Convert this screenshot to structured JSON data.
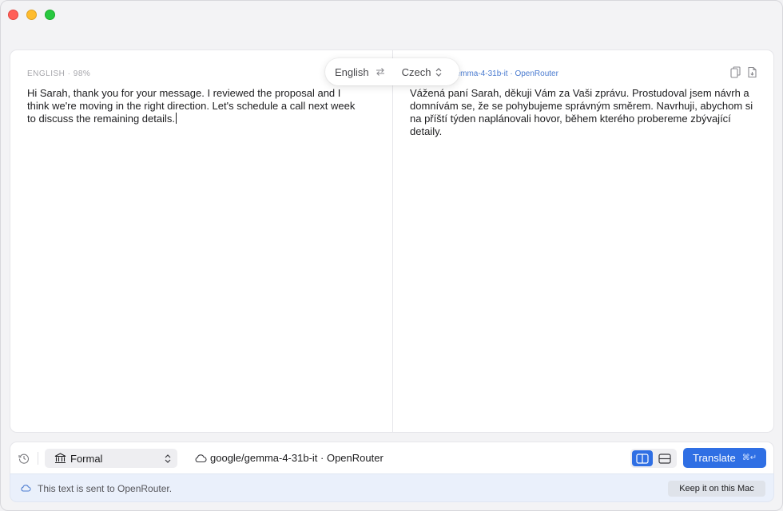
{
  "source": {
    "meta": "ENGLISH · 98%",
    "text": "Hi Sarah, thank you for your message. I reviewed the proposal and I think we're moving in the right direction. Let's schedule a call next week to discuss the remaining details."
  },
  "target": {
    "meta": "gemma-4-31b-it · OpenRouter",
    "text": "Vážená paní Sarah, děkuji Vám za Vaši zprávu. Prostudoval jsem návrh a domnívám se, že se pohybujeme správným směrem. Navrhuji, abychom si na příští týden naplánovali hovor, během kterého probereme zbývající detaily."
  },
  "language_pill": {
    "source_lang": "English",
    "target_lang": "Czech"
  },
  "toolbar": {
    "tone": "Formal",
    "model": "google/gemma-4-31b-it · OpenRouter",
    "translate_label": "Translate",
    "translate_shortcut": "⌘↵"
  },
  "notice": {
    "text": "This text is sent to OpenRouter.",
    "keep_label": "Keep it on this Mac"
  },
  "colors": {
    "accent": "#2f6fe4",
    "notice_bg": "#eaf0fb"
  },
  "icons": {
    "copy": "copy-icon",
    "export": "document-icon",
    "swap": "swap-arrows-icon",
    "history": "history-icon",
    "tone": "bank-icon",
    "cloud": "cloud-icon",
    "split": "split-view-icon",
    "stack": "stacked-view-icon"
  }
}
